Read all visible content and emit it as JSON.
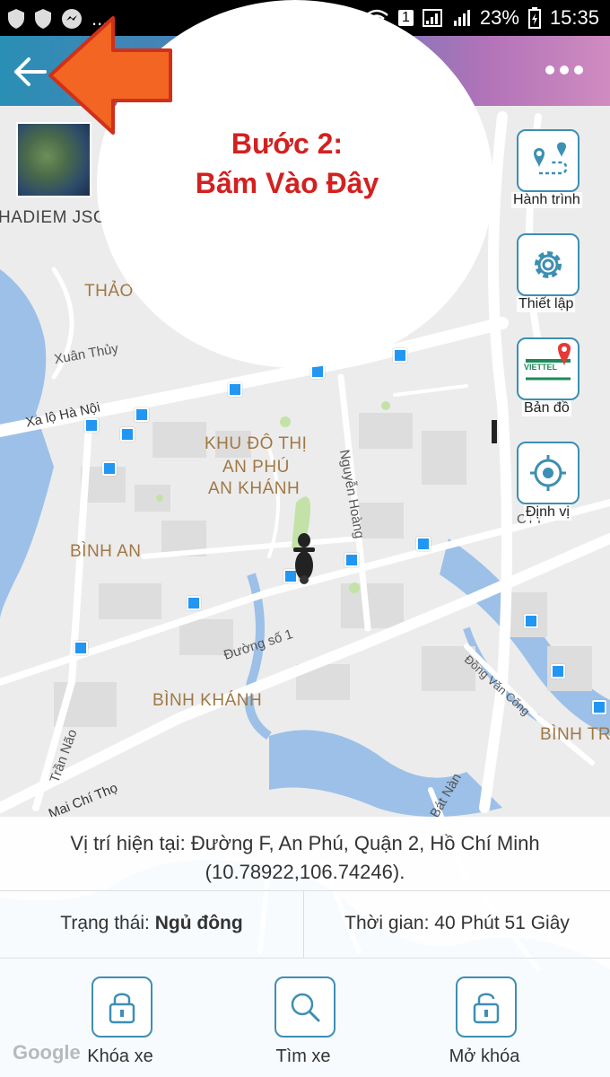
{
  "status_bar": {
    "signal_text": "1",
    "battery": "23%",
    "time": "15:35",
    "dots": "..."
  },
  "map_labels": {
    "company": "HADIEM JSC",
    "thao_dien": "THẢO Đ",
    "xuan_thuy": "Xuân Thủy",
    "xa_lo": "Xa lộ Hà Nội",
    "khu_do_thi_1": "KHU ĐÔ THỊ",
    "khu_do_thi_2": "AN PHÚ",
    "khu_do_thi_3": "AN KHÁNH",
    "nguyen_hoang": "Nguyễn Hoàng",
    "binh_an": "BÌNH AN",
    "duong_so_1": "Đường số 1",
    "binh_khanh": "BÌNH KHÁNH",
    "dong_van_cong": "Đồng Văn Cống",
    "binh_tr": "BÌNH TR",
    "tran_nao": "Trần Não",
    "mai_chi_tho": "Mai Chí Thọ",
    "bat_nan": "Bát Nàn",
    "cty": "CTY",
    "google": "Google"
  },
  "side_buttons": {
    "route": "Hành trình",
    "settings": "Thiết lập",
    "map": "Bản đồ",
    "locate": "Định vị",
    "viettel": "VIETTEL"
  },
  "annotation": {
    "line1": "Bước 2:",
    "line2": "Bấm Vào Đây"
  },
  "info": {
    "address": "Vị trí hiện tại: Đường F, An Phú, Quận 2, Hồ Chí Minh",
    "coords": "(10.78922,106.74246).",
    "status_label": "Trạng thái: ",
    "status_value": "Ngủ đông",
    "time_text": "Thời gian: 40 Phút 51 Giây"
  },
  "actions": {
    "lock": "Khóa xe",
    "find": "Tìm xe",
    "unlock": "Mở khóa"
  },
  "colors": {
    "accent": "#3d8fb3",
    "annotation": "#d32020",
    "arrow": "#f26522"
  }
}
